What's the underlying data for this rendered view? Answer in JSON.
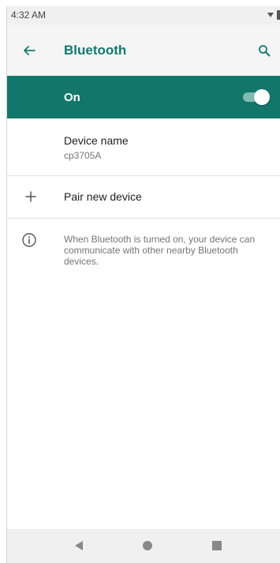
{
  "status_bar": {
    "time": "4:32 AM",
    "icons": [
      "wifi-icon",
      "battery-icon"
    ]
  },
  "app_bar": {
    "title": "Bluetooth",
    "back_icon": "arrow-left-icon",
    "search_icon": "search-icon"
  },
  "master_switch": {
    "label": "On",
    "state": "on"
  },
  "device_name": {
    "title": "Device name",
    "value": "cp3705A"
  },
  "pair_new": {
    "label": "Pair new device",
    "icon": "plus-icon"
  },
  "info": {
    "icon": "info-icon",
    "text": "When Bluetooth is turned on, your device can communicate with other nearby Bluetooth devices."
  },
  "nav_bar": {
    "buttons": [
      "back-triangle-icon",
      "home-circle-icon",
      "recents-square-icon"
    ]
  },
  "colors": {
    "accent": "#13766a",
    "title": "#127a6c"
  }
}
